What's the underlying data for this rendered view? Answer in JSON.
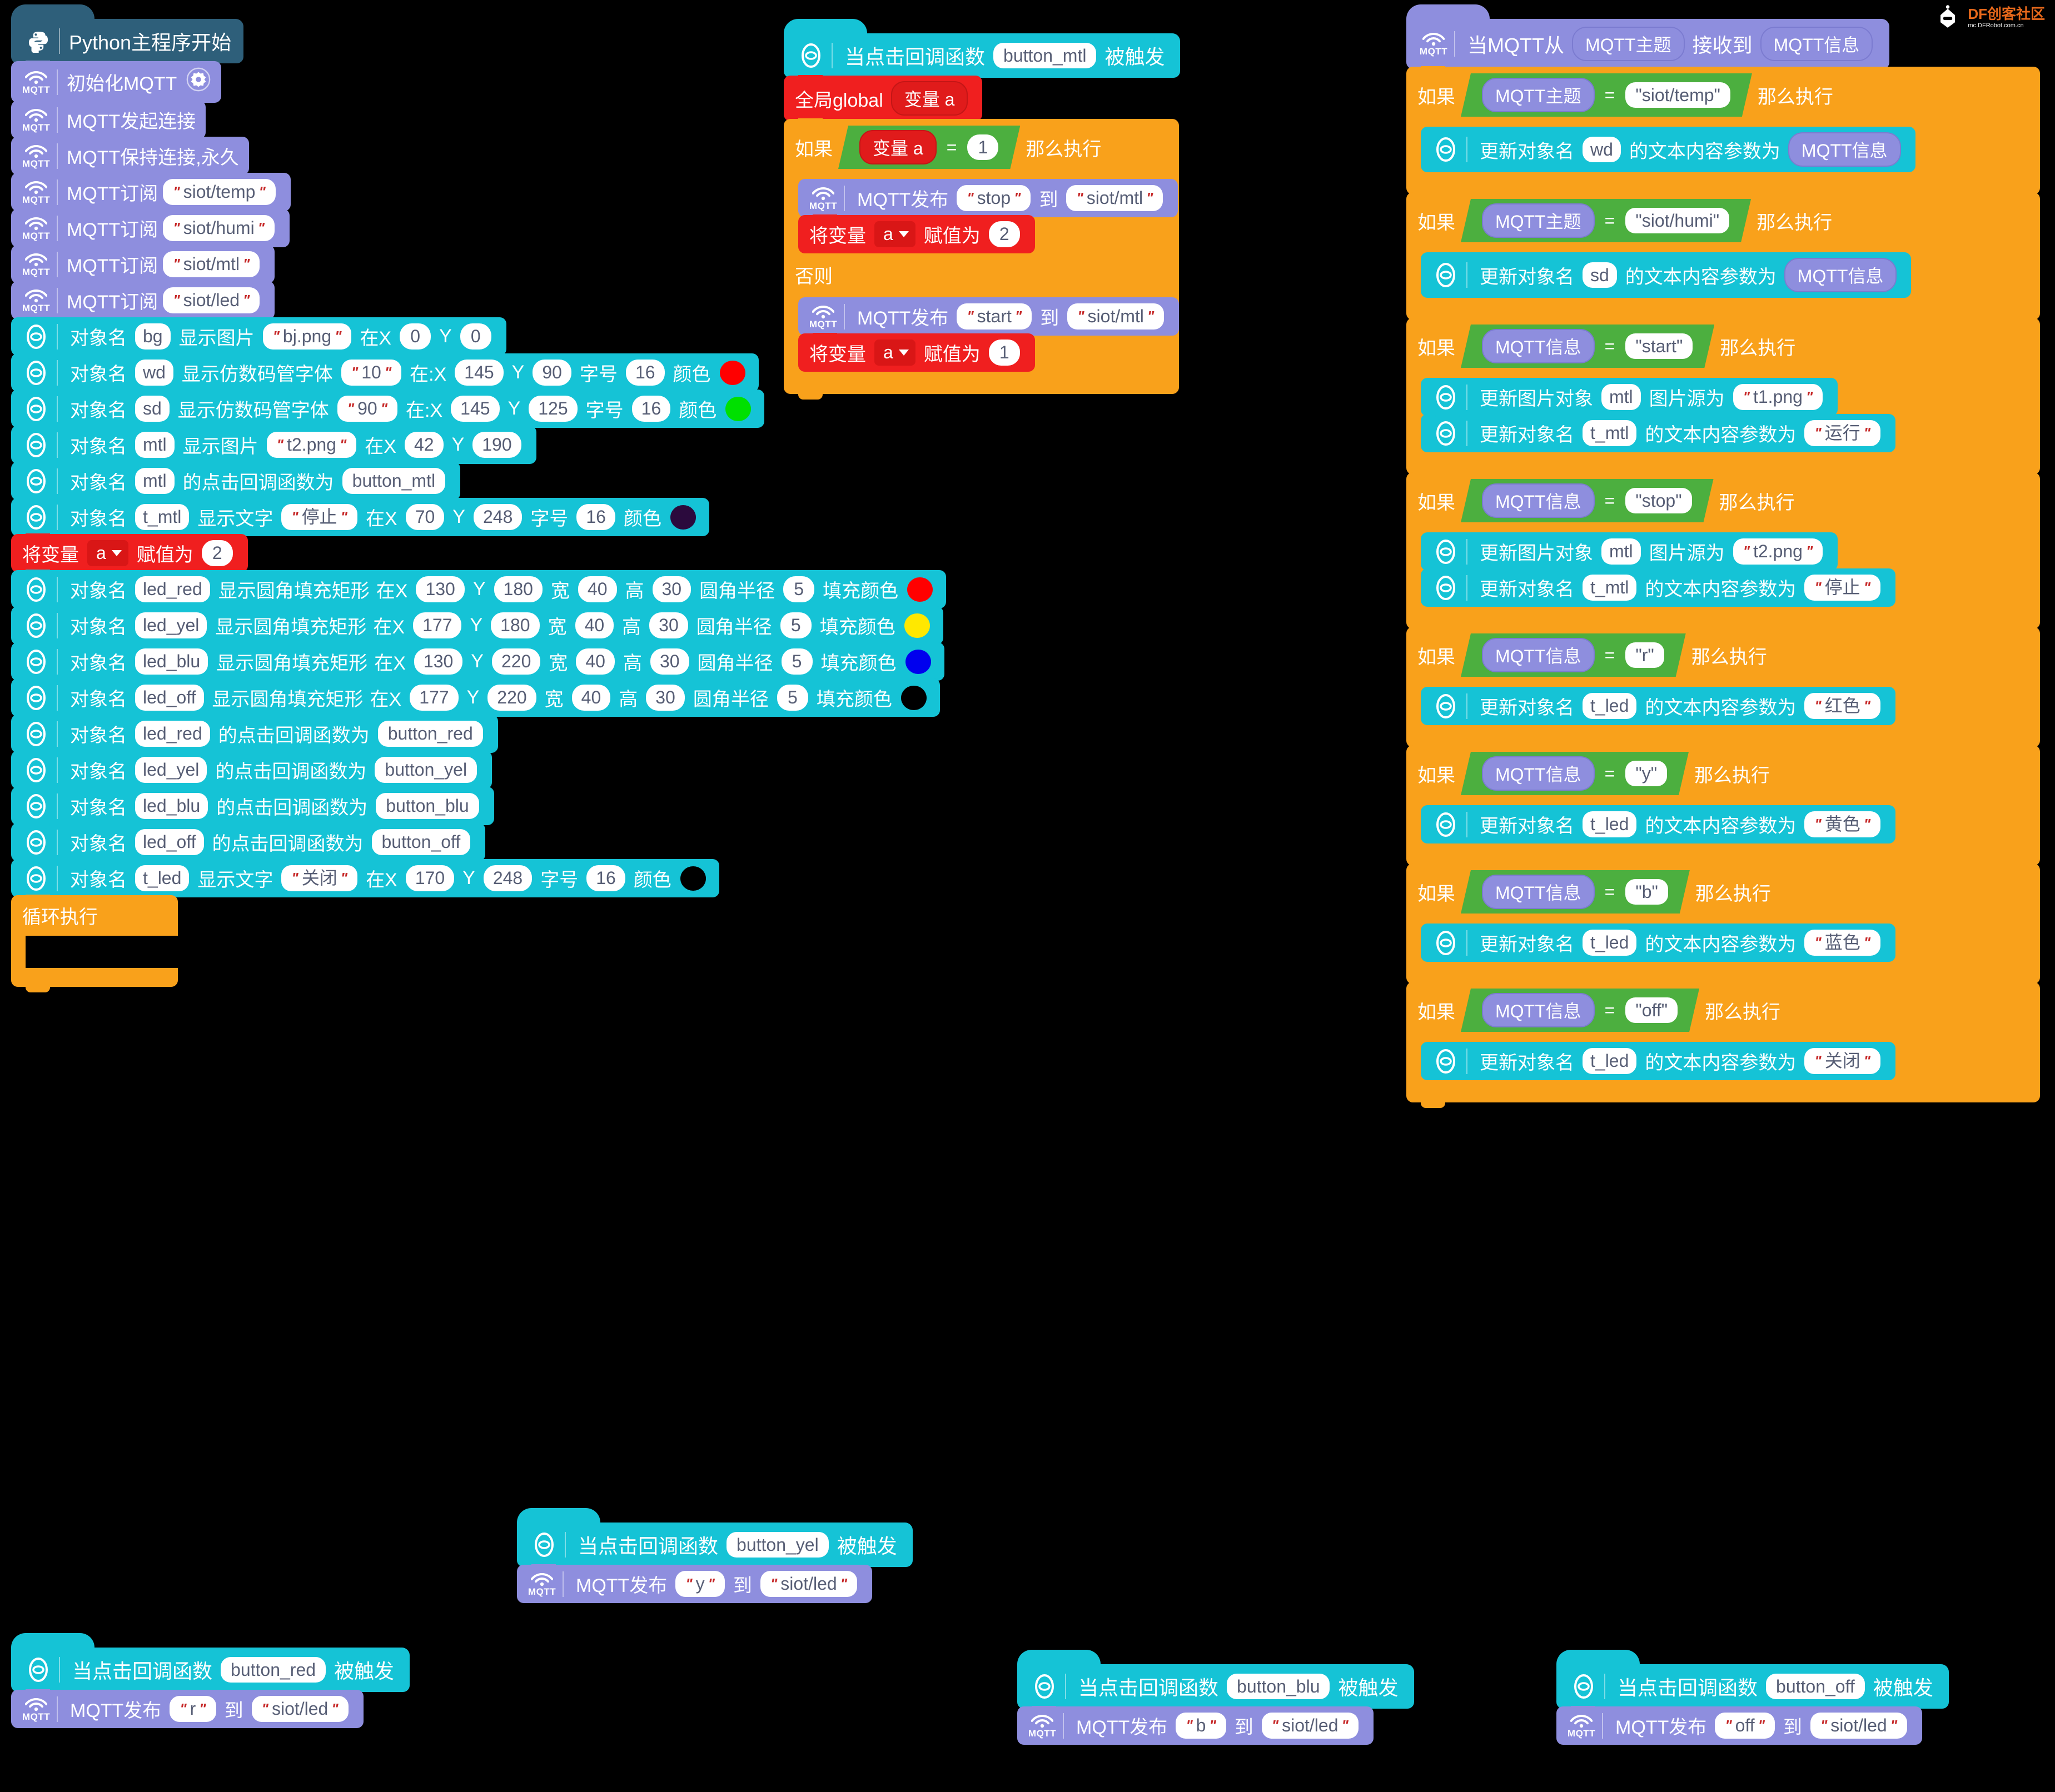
{
  "watermark": {
    "brand": "DF创客社区",
    "url": "mc.DFRobot.com.cn"
  },
  "labels": {
    "obj_name": "对象名",
    "show_image": "显示图片",
    "show_seg_font": "显示仿数码管字体",
    "show_text": "显示文字",
    "show_round_rect": "显示圆角填充矩形",
    "at_x": "在X",
    "at_x_colon": "在:X",
    "y": "Y",
    "width": "宽",
    "height": "高",
    "corner_radius": "圆角半径",
    "fill_color": "填充颜色",
    "font_size": "字号",
    "color": "颜色",
    "click_callback_is": "的点击回调函数为",
    "when_click_callback": "当点击回调函数",
    "triggered": "被触发",
    "mqtt_publish": "MQTT发布",
    "to": "到",
    "mqtt_subscribe": "MQTT订阅",
    "if": "如果",
    "then_do": "那么执行",
    "else": "否则",
    "set_var": "将变量",
    "assign_to": "赋值为",
    "global": "全局global",
    "var_a": "变量 a",
    "loop_forever": "循环执行",
    "update_obj_name": "更新对象名",
    "text_content_param": "的文本内容参数为",
    "update_image_obj": "更新图片对象",
    "image_src_is": "图片源为",
    "when_mqtt_from": "当MQTT从",
    "received": "接收到",
    "mqtt_topic": "MQTT主题",
    "mqtt_message": "MQTT信息",
    "mqtt_icon_text": "MQTT",
    "equals": "="
  },
  "colors": {
    "mqtt_purple": "#8e8ede",
    "cyan": "#15c3d6",
    "red": "#f01f1f",
    "orange": "#f9a11b",
    "green": "#4caf3f",
    "hat_dark": "#2e5f7a"
  },
  "main_stack": {
    "hat_label": "Python主程序开始",
    "hat_icon": "python-icon",
    "blocks": [
      {
        "kind": "mqtt",
        "label": "初始化MQTT",
        "gear": true
      },
      {
        "kind": "mqtt",
        "label": "MQTT发起连接"
      },
      {
        "kind": "mqtt",
        "label": "MQTT保持连接,永久"
      },
      {
        "kind": "mqtt_sub",
        "topic": "siot/temp"
      },
      {
        "kind": "mqtt_sub",
        "topic": "siot/humi"
      },
      {
        "kind": "mqtt_sub",
        "topic": "siot/mtl"
      },
      {
        "kind": "mqtt_sub",
        "topic": "siot/led"
      }
    ],
    "display_blocks": [
      {
        "type": "image",
        "obj": "bg",
        "value": "bj.png",
        "x": "0",
        "y": "0"
      },
      {
        "type": "seg",
        "obj": "wd",
        "value": "10",
        "x": "145",
        "y": "90",
        "font": "16",
        "color": "#ff0000"
      },
      {
        "type": "seg",
        "obj": "sd",
        "value": "90",
        "x": "145",
        "y": "125",
        "font": "16",
        "color": "#00e000"
      },
      {
        "type": "image",
        "obj": "mtl",
        "value": "t2.png",
        "x": "42",
        "y": "190"
      },
      {
        "type": "callback",
        "obj": "mtl",
        "callback": "button_mtl"
      },
      {
        "type": "text",
        "obj": "t_mtl",
        "value": "停止",
        "x": "70",
        "y": "248",
        "font": "16",
        "color": "#2b0a3d"
      }
    ],
    "set_var_a": {
      "var": "a",
      "value": "2"
    },
    "led_rects": [
      {
        "obj": "led_red",
        "x": "130",
        "y": "180",
        "w": "40",
        "h": "30",
        "r": "5",
        "color": "#ff0000"
      },
      {
        "obj": "led_yel",
        "x": "177",
        "y": "180",
        "w": "40",
        "h": "30",
        "r": "5",
        "color": "#ffe800"
      },
      {
        "obj": "led_blu",
        "x": "130",
        "y": "220",
        "w": "40",
        "h": "30",
        "r": "5",
        "color": "#0000ee"
      },
      {
        "obj": "led_off",
        "x": "177",
        "y": "220",
        "w": "40",
        "h": "30",
        "r": "5",
        "color": "#000000"
      }
    ],
    "led_callbacks": [
      {
        "obj": "led_red",
        "callback": "button_red"
      },
      {
        "obj": "led_yel",
        "callback": "button_yel"
      },
      {
        "obj": "led_blu",
        "callback": "button_blu"
      },
      {
        "obj": "led_off",
        "callback": "button_off"
      }
    ],
    "t_led": {
      "obj": "t_led",
      "value": "关闭",
      "x": "170",
      "y": "248",
      "font": "16",
      "color": "#000000"
    },
    "loop_label": "循环执行"
  },
  "button_mtl_stack": {
    "hat_callback": "button_mtl",
    "global_var": "变量 a",
    "if_cond": {
      "left": "变量 a",
      "right": "1"
    },
    "then_branch": [
      {
        "kind": "publish",
        "message": "stop",
        "topic": "siot/mtl"
      },
      {
        "kind": "setvar",
        "var": "a",
        "value": "2"
      }
    ],
    "else_branch": [
      {
        "kind": "publish",
        "message": "start",
        "topic": "siot/mtl"
      },
      {
        "kind": "setvar",
        "var": "a",
        "value": "1"
      }
    ]
  },
  "mqtt_receive_stack": {
    "hat_prefix": "当MQTT从",
    "hat_topic": "MQTT主题",
    "hat_mid": "接收到",
    "hat_message": "MQTT信息",
    "branches": [
      {
        "left": "MQTT主题",
        "right": "\"siot/temp\"",
        "body": [
          {
            "type": "update_text",
            "obj": "wd",
            "value_reporter": "MQTT信息"
          }
        ]
      },
      {
        "left": "MQTT主题",
        "right": "\"siot/humi\"",
        "body": [
          {
            "type": "update_text",
            "obj": "sd",
            "value_reporter": "MQTT信息"
          }
        ]
      },
      {
        "left": "MQTT信息",
        "right": "\"start\"",
        "body": [
          {
            "type": "update_image",
            "obj": "mtl",
            "value": "t1.png"
          },
          {
            "type": "update_text_str",
            "obj": "t_mtl",
            "value": "运行"
          }
        ]
      },
      {
        "left": "MQTT信息",
        "right": "\"stop\"",
        "body": [
          {
            "type": "update_image",
            "obj": "mtl",
            "value": "t2.png"
          },
          {
            "type": "update_text_str",
            "obj": "t_mtl",
            "value": "停止"
          }
        ]
      },
      {
        "left": "MQTT信息",
        "right": "\"r\"",
        "body": [
          {
            "type": "update_text_str",
            "obj": "t_led",
            "value": "红色"
          }
        ]
      },
      {
        "left": "MQTT信息",
        "right": "\"y\"",
        "body": [
          {
            "type": "update_text_str",
            "obj": "t_led",
            "value": "黄色"
          }
        ]
      },
      {
        "left": "MQTT信息",
        "right": "\"b\"",
        "body": [
          {
            "type": "update_text_str",
            "obj": "t_led",
            "value": "蓝色"
          }
        ]
      },
      {
        "left": "MQTT信息",
        "right": "\"off\"",
        "body": [
          {
            "type": "update_text_str",
            "obj": "t_led",
            "value": "关闭"
          }
        ]
      }
    ]
  },
  "button_stacks": [
    {
      "id": "yel",
      "callback": "button_yel",
      "message": "y",
      "topic": "siot/led"
    },
    {
      "id": "red",
      "callback": "button_red",
      "message": "r",
      "topic": "siot/led"
    },
    {
      "id": "blu",
      "callback": "button_blu",
      "message": "b",
      "topic": "siot/led"
    },
    {
      "id": "off",
      "callback": "button_off",
      "message": "off",
      "topic": "siot/led"
    }
  ]
}
